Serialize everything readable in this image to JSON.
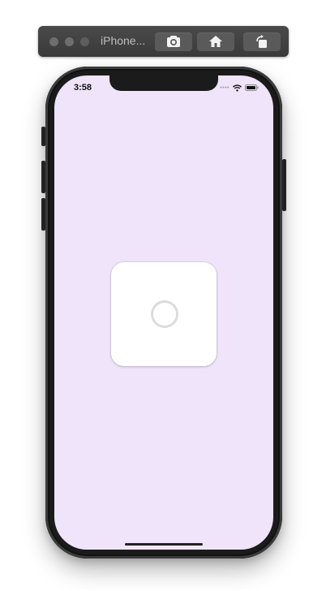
{
  "toolbar": {
    "device_label": "iPhone...",
    "buttons": [
      {
        "icon": "screenshot-icon"
      },
      {
        "icon": "home-icon"
      },
      {
        "icon": "rotate-icon"
      }
    ]
  },
  "status_bar": {
    "time": "3:58",
    "icons": [
      "cellular-dots-icon",
      "wifi-icon",
      "battery-icon"
    ]
  },
  "content": {
    "card": {
      "icon": "spinner-ring-icon"
    }
  },
  "colors": {
    "screen_background": "#efe4f9",
    "card_background": "#ffffff",
    "spinner_ring": "#dcdcdc",
    "toolbar_background": "#404040"
  }
}
